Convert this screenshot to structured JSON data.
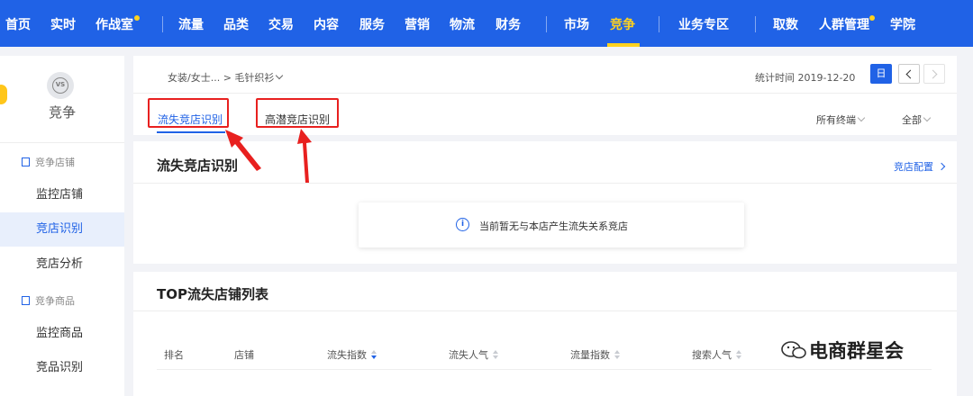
{
  "topnav": {
    "items": [
      "首页",
      "实时",
      "作战室",
      "流量",
      "品类",
      "交易",
      "内容",
      "服务",
      "营销",
      "物流",
      "财务",
      "市场",
      "竞争",
      "业务专区",
      "取数",
      "人群管理",
      "学院"
    ],
    "active": "竞争"
  },
  "sidebar": {
    "logo_text": "VS",
    "title": "竞争",
    "group_shop": "竞争店铺",
    "items_shop": [
      "监控店铺",
      "竞店识别",
      "竞店分析"
    ],
    "group_goods": "竞争商品",
    "items_goods": [
      "监控商品",
      "竞品识别"
    ],
    "active_item": "竞店识别"
  },
  "header": {
    "breadcrumb_category": "女装/女士...",
    "breadcrumb_sep": ">",
    "breadcrumb_sub": "毛针织衫",
    "stat_time": "统计时间 2019-12-20",
    "day_button": "日"
  },
  "tabs": [
    "流失竞店识别",
    "高潜竞店识别"
  ],
  "filters": {
    "category": "所有终端",
    "scope": "全部"
  },
  "loss_section": {
    "title": "流失竞店识别",
    "config_link": "竞店配置",
    "empty_icon": "i",
    "empty_text": "当前暂无与本店产生流失关系竞店"
  },
  "top_list": {
    "title": "TOP流失店铺列表",
    "columns": [
      "排名",
      "店铺",
      "流失指数",
      "流失人气",
      "流量指数",
      "搜索人气"
    ]
  },
  "watermark": "电商群星会",
  "colors": {
    "brand_blue": "#2062e6",
    "active_yellow": "#ffd21e",
    "annotation_red": "#e8201f"
  }
}
